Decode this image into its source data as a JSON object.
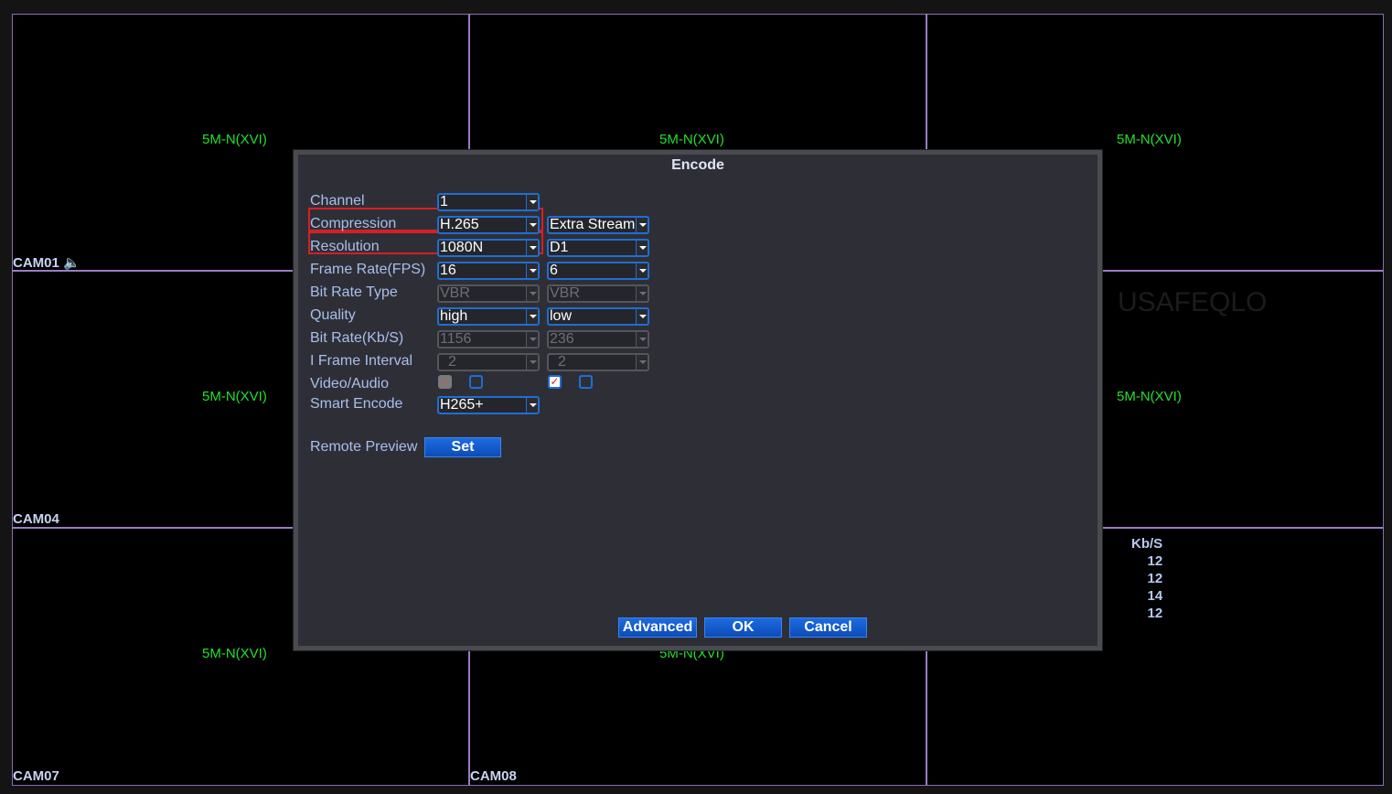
{
  "cameras": {
    "cam01": "CAM01",
    "cam04": "CAM04",
    "cam07": "CAM07",
    "cam08": "CAM08"
  },
  "channel_type": "5M-N(XVI)",
  "watermark": "USAFEQLO",
  "bitrate_panel": {
    "header": "Kb/S",
    "values": [
      "12",
      "12",
      "14",
      "12"
    ]
  },
  "dialog": {
    "title": "Encode",
    "labels": {
      "channel": "Channel",
      "compression": "Compression",
      "resolution": "Resolution",
      "frame_rate": "Frame Rate(FPS)",
      "bit_rate_type": "Bit Rate Type",
      "quality": "Quality",
      "bit_rate": "Bit Rate(Kb/S)",
      "iframe": "I Frame Interval",
      "video_audio": "Video/Audio",
      "smart_encode": "Smart Encode",
      "remote_preview": "Remote Preview"
    },
    "main": {
      "channel": "1",
      "compression": "H.265",
      "resolution": "1080N",
      "frame_rate": "16",
      "bit_rate_type": "VBR",
      "quality": "high",
      "bit_rate": "1156",
      "iframe": "2",
      "smart_encode": "H265+"
    },
    "extra": {
      "stream": "Extra Stream",
      "resolution": "D1",
      "frame_rate": "6",
      "bit_rate_type": "VBR",
      "quality": "low",
      "bit_rate": "236",
      "iframe": "2"
    },
    "buttons": {
      "set": "Set",
      "advanced": "Advanced",
      "ok": "OK",
      "cancel": "Cancel"
    }
  }
}
